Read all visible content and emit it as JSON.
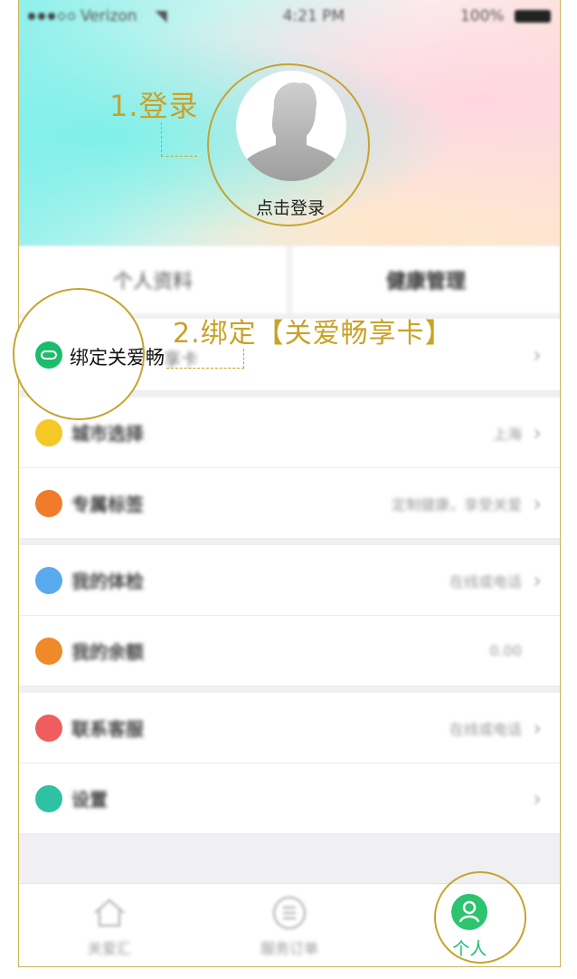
{
  "status_bar": {
    "carrier": "Verizon",
    "time": "4:21 PM",
    "battery": "100%"
  },
  "header": {
    "login_text": "点击登录"
  },
  "annotations": {
    "step1": "1.登录",
    "step2": "2.绑定【关爱畅享卡】"
  },
  "segments": [
    {
      "label": "个人资料"
    },
    {
      "label": "健康管理"
    }
  ],
  "bind_card": {
    "label_clear": "绑定关爱畅",
    "label_blurred": "享卡"
  },
  "menu": [
    {
      "label": "城市选择",
      "value": "上海",
      "color": "#f5c825",
      "chevron": true
    },
    {
      "label": "专属标签",
      "value": "定制健康，享受关爱",
      "color": "#f07b2b",
      "chevron": true
    },
    {
      "label": "我的体检",
      "value": "在线或电话",
      "color": "#5aaaf0",
      "chevron": true
    },
    {
      "label": "我的余额",
      "value": "0.00",
      "color": "#f08a28",
      "chevron": false
    },
    {
      "label": "联系客服",
      "value": "在线或电话",
      "color": "#ef5d5d",
      "chevron": true
    },
    {
      "label": "设置",
      "value": "",
      "color": "#2fc1a4",
      "chevron": true
    }
  ],
  "tabbar": [
    {
      "label": "关爱汇",
      "icon": "home-icon"
    },
    {
      "label": "服务订单",
      "icon": "list-icon"
    },
    {
      "label": "个人",
      "icon": "person-icon",
      "active": true
    }
  ],
  "colors": {
    "accent": "#1bbd6b",
    "annotation": "#c9a227"
  }
}
